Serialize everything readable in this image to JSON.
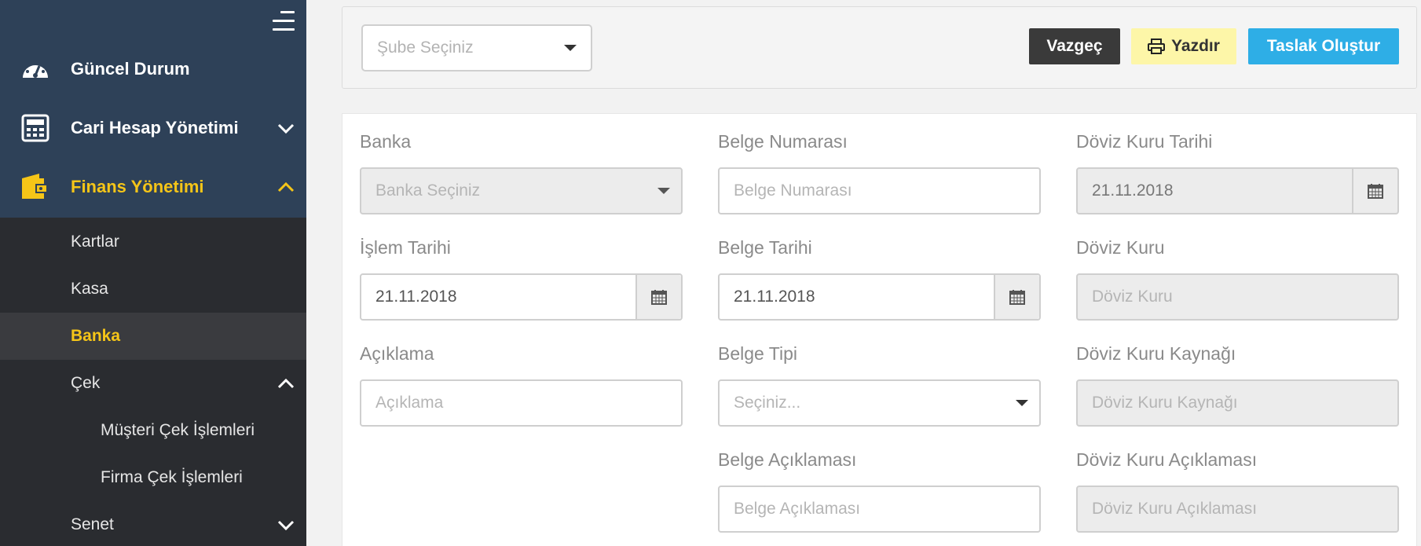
{
  "sidebar": {
    "menu": [
      {
        "label": "Güncel Durum",
        "icon": "dashboard-gauge-icon"
      },
      {
        "label": "Cari Hesap Yönetimi",
        "icon": "calculator-icon"
      },
      {
        "label": "Finans Yönetimi",
        "icon": "wallet-icon"
      }
    ],
    "submenu": [
      {
        "label": "Kartlar"
      },
      {
        "label": "Kasa"
      },
      {
        "label": "Banka"
      },
      {
        "label": "Çek"
      },
      {
        "label": "Müşteri Çek İşlemleri"
      },
      {
        "label": "Firma Çek İşlemleri"
      },
      {
        "label": "Senet"
      }
    ]
  },
  "toolbar": {
    "branch_placeholder": "Şube Seçiniz",
    "cancel_label": "Vazgeç",
    "print_label": "Yazdır",
    "draft_label": "Taslak Oluştur"
  },
  "form": {
    "bank": {
      "label": "Banka",
      "placeholder": "Banka Seçiniz"
    },
    "doc_number": {
      "label": "Belge Numarası",
      "placeholder": "Belge Numarası"
    },
    "fx_date": {
      "label": "Döviz Kuru Tarihi",
      "value": "21.11.2018"
    },
    "tx_date": {
      "label": "İşlem Tarihi",
      "value": "21.11.2018"
    },
    "doc_date": {
      "label": "Belge Tarihi",
      "value": "21.11.2018"
    },
    "fx_rate": {
      "label": "Döviz Kuru",
      "placeholder": "Döviz Kuru"
    },
    "description": {
      "label": "Açıklama",
      "placeholder": "Açıklama"
    },
    "doc_type": {
      "label": "Belge Tipi",
      "placeholder": "Seçiniz..."
    },
    "fx_source": {
      "label": "Döviz Kuru Kaynağı",
      "placeholder": "Döviz Kuru Kaynağı"
    },
    "doc_description": {
      "label": "Belge Açıklaması",
      "placeholder": "Belge Açıklaması"
    },
    "fx_description": {
      "label": "Döviz Kuru Açıklaması",
      "placeholder": "Döviz Kuru Açıklaması"
    }
  },
  "colors": {
    "sidebar_top": "#2e4158",
    "sidebar_bottom": "#2a2c30",
    "active_accent": "#f5c518",
    "btn_dark": "#3a3a3a",
    "btn_yellow": "#fdf6a8",
    "btn_blue": "#2eaee6"
  }
}
